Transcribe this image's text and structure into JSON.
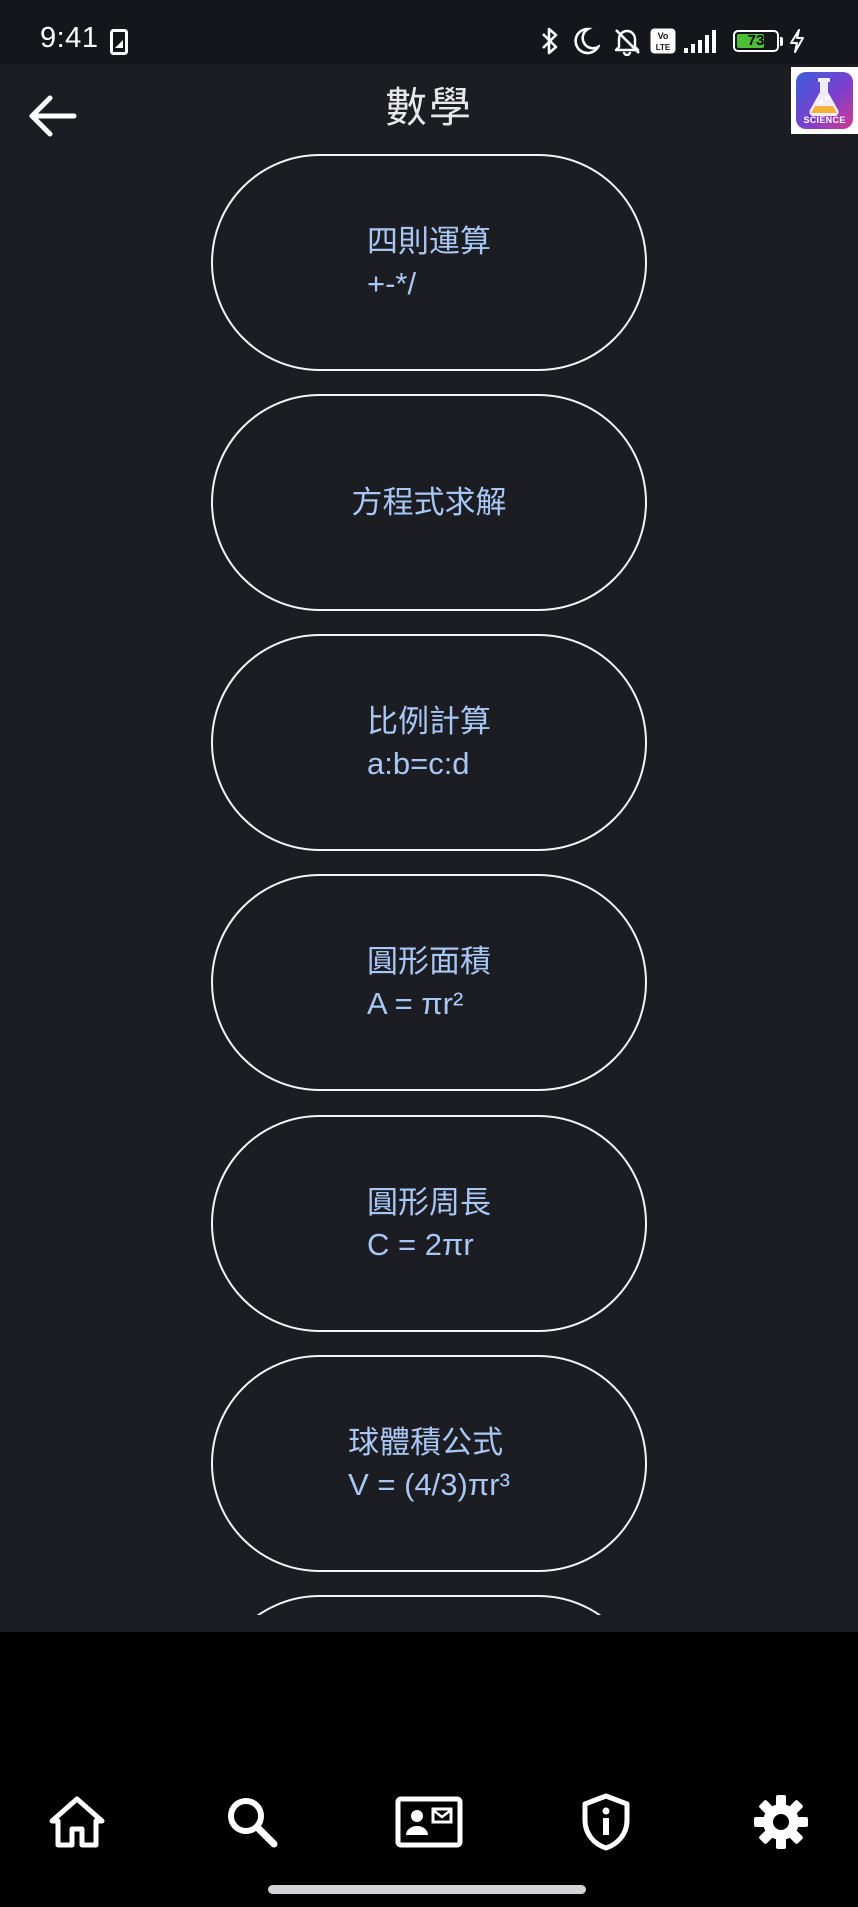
{
  "status_bar": {
    "time": "9:41",
    "battery_level": 73,
    "battery_text": "73",
    "network": "Vo LTE",
    "icons": [
      "sim-card-icon",
      "bluetooth-icon",
      "moon-icon",
      "bell-off-icon",
      "volte-icon",
      "signal-icon",
      "battery-icon",
      "charging-icon"
    ]
  },
  "header": {
    "title": "數學",
    "back_icon": "arrow-left-icon",
    "logo_text": "SCIENCE"
  },
  "topics": [
    {
      "title": "四則運算",
      "subtitle": "+-*/"
    },
    {
      "title": "方程式求解",
      "subtitle": ""
    },
    {
      "title": "比例計算",
      "subtitle": "a:b=c:d"
    },
    {
      "title": "圓形面積",
      "subtitle": "A = πr²"
    },
    {
      "title": "圓形周長",
      "subtitle": "C = 2πr"
    },
    {
      "title": "球體積公式",
      "subtitle": "V = (4/3)πr³"
    }
  ],
  "bottom_nav": {
    "items": [
      "home-icon",
      "search-icon",
      "contact-card-icon",
      "shield-info-icon",
      "gear-icon"
    ]
  },
  "colors": {
    "background": "#1b1d22",
    "accent_text": "#a9c7f5",
    "outline": "#f4f4f6",
    "battery": "#4cbe37"
  }
}
